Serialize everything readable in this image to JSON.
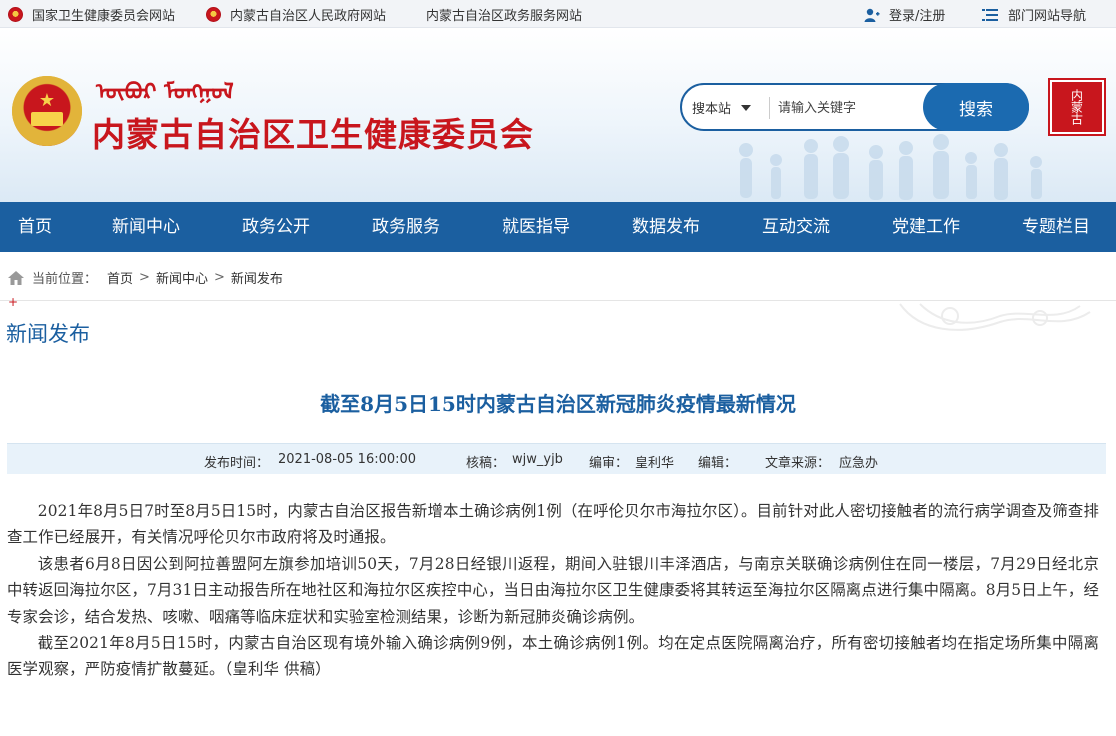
{
  "topbar": {
    "links": [
      "国家卫生健康委员会网站",
      "内蒙古自治区人民政府网站",
      "内蒙古自治区政务服务网站"
    ],
    "login": "登录/注册",
    "dept_nav": "部门网站导航"
  },
  "header": {
    "mongolian_title": "ᠦᠪᠦᠷ ᠮᠣᠩᠭᠣᠯ",
    "site_title": "内蒙古自治区卫生健康委员会",
    "seal_text": "内蒙古"
  },
  "search": {
    "scope": "搜本站",
    "placeholder": "请输入关键字",
    "button": "搜索"
  },
  "nav": [
    "首页",
    "新闻中心",
    "政务公开",
    "政务服务",
    "就医指导",
    "数据发布",
    "互动交流",
    "党建工作",
    "专题栏目"
  ],
  "breadcrumb": {
    "prefix": "当前位置：",
    "items": [
      "首页",
      "新闻中心",
      "新闻发布"
    ],
    "separator": ">"
  },
  "section_title": "新闻发布",
  "article": {
    "title": "截至8月5日15时内蒙古自治区新冠肺炎疫情最新情况",
    "meta": {
      "publish_label": "发布时间：",
      "publish_value": "2021-08-05 16:00:00",
      "check_label": "核稿：",
      "check_value": "wjw_yjb",
      "author_label": "编审：",
      "author_value": "皇利华",
      "editor_label": "编辑：",
      "source_label": "文章来源：",
      "source_value": "应急办"
    },
    "paragraphs": [
      "2021年8月5日7时至8月5日15时，内蒙古自治区报告新增本土确诊病例1例（在呼伦贝尔市海拉尔区）。目前针对此人密切接触者的流行病学调查及筛查排查工作已经展开，有关情况呼伦贝尔市政府将及时通报。",
      "该患者6月8日因公到阿拉善盟阿左旗参加培训50天，7月28日经银川返程，期间入驻银川丰泽酒店，与南京关联确诊病例住在同一楼层，7月29日经北京中转返回海拉尔区，7月31日主动报告所在地社区和海拉尔区疾控中心，当日由海拉尔区卫生健康委将其转运至海拉尔区隔离点进行集中隔离。8月5日上午，经专家会诊，结合发热、咳嗽、咽痛等临床症状和实验室检测结果，诊断为新冠肺炎确诊病例。",
      "截至2021年8月5日15时，内蒙古自治区现有境外输入确诊病例9例，本土确诊病例1例。均在定点医院隔离治疗，所有密切接触者均在指定场所集中隔离医学观察，严防疫情扩散蔓延。（皇利华 供稿）"
    ]
  },
  "colors": {
    "primary_blue": "#1b5fa0",
    "brand_red": "#c8161d",
    "meta_bg": "#e8f2fa"
  }
}
